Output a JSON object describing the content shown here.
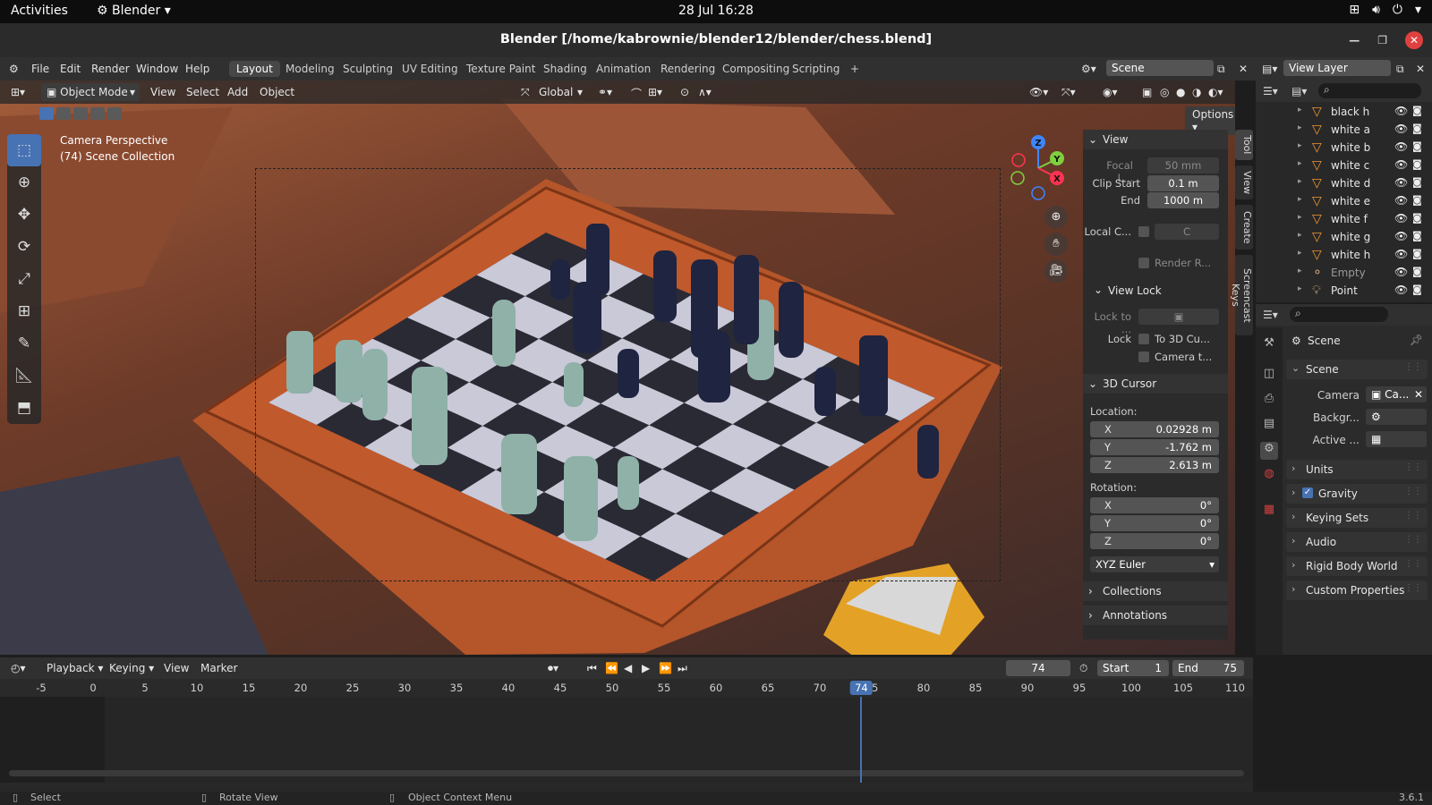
{
  "gnome": {
    "activities": "Activities",
    "app_name": "Blender",
    "clock": "28 Jul  16:28",
    "tray_icons": [
      "network-icon",
      "volume-icon",
      "power-icon"
    ]
  },
  "window": {
    "title": "Blender [/home/kabrownie/blender12/blender/chess.blend]"
  },
  "menu": {
    "items": [
      "File",
      "Edit",
      "Render",
      "Window",
      "Help"
    ],
    "workspaces": [
      "Layout",
      "Modeling",
      "Sculpting",
      "UV Editing",
      "Texture Paint",
      "Shading",
      "Animation",
      "Rendering",
      "Compositing",
      "Scripting"
    ],
    "active_workspace": "Layout",
    "add_tab": "+",
    "scene_name": "Scene",
    "view_layer": "View Layer"
  },
  "viewport": {
    "mode": "Object Mode",
    "menus": [
      "View",
      "Select",
      "Add",
      "Object"
    ],
    "transform_orientation": "Global",
    "options_label": "Options",
    "info_line1": "Camera Perspective",
    "info_line2": "(74) Scene Collection",
    "gizmo_axes": [
      "Z",
      "Y",
      "X"
    ]
  },
  "npanel": {
    "tabs": [
      "Tool",
      "View",
      "Create",
      "Screencast Keys"
    ],
    "view_header": "View",
    "focal_label": "Focal L...",
    "focal_value": "50 mm",
    "clip_start_label": "Clip Start",
    "clip_start_value": "0.1 m",
    "end_label": "End",
    "end_value": "1000 m",
    "local_camera_label": "Local C...",
    "local_camera_value": "C",
    "render_region": "Render R...",
    "view_lock_header": "View Lock",
    "lock_to_label": "Lock to ...",
    "lock_label": "Lock",
    "lock_3d_cursor": "To 3D Cu...",
    "lock_camera": "Camera t...",
    "cursor_header": "3D Cursor",
    "location_label": "Location:",
    "loc_x": "0.02928 m",
    "loc_y": "-1.762 m",
    "loc_z": "2.613 m",
    "rotation_label": "Rotation:",
    "rot_x": "0°",
    "rot_y": "0°",
    "rot_z": "0°",
    "rotation_mode": "XYZ Euler",
    "collections": "Collections",
    "annotations": "Annotations",
    "axis_x": "X",
    "axis_y": "Y",
    "axis_z": "Z"
  },
  "outliner": {
    "rows": [
      {
        "name": "black h",
        "type": "mesh"
      },
      {
        "name": "white a",
        "type": "mesh"
      },
      {
        "name": "white b",
        "type": "mesh"
      },
      {
        "name": "white c",
        "type": "mesh"
      },
      {
        "name": "white d",
        "type": "mesh"
      },
      {
        "name": "white e",
        "type": "mesh"
      },
      {
        "name": "white f",
        "type": "mesh"
      },
      {
        "name": "white g",
        "type": "mesh"
      },
      {
        "name": "white h",
        "type": "mesh"
      },
      {
        "name": "Empty",
        "type": "empty"
      },
      {
        "name": "Point",
        "type": "light"
      }
    ]
  },
  "properties": {
    "title": "Scene",
    "section": "Scene",
    "camera_label": "Camera",
    "camera_value": "Ca...",
    "background_label": "Backgr...",
    "active_label": "Active ...",
    "panels": [
      "Units",
      "Gravity",
      "Keying Sets",
      "Audio",
      "Rigid Body World",
      "Custom Properties"
    ],
    "gravity_checked": true
  },
  "timeline": {
    "menus": [
      "Playback",
      "Keying",
      "View",
      "Marker"
    ],
    "current_frame": "74",
    "start_label": "Start",
    "start_value": "1",
    "end_label": "End",
    "end_value": "75",
    "ticks": [
      "-5",
      "0",
      "5",
      "10",
      "15",
      "20",
      "25",
      "30",
      "35",
      "40",
      "45",
      "50",
      "55",
      "60",
      "65",
      "70",
      "75",
      "80",
      "85",
      "90",
      "95",
      "100",
      "105",
      "110"
    ]
  },
  "statusbar": {
    "select": "Select",
    "rotate": "Rotate View",
    "context": "Object Context Menu",
    "version": "3.6.1"
  },
  "colors": {
    "accent": "#4772b3",
    "board_wood": "#c0592c",
    "white_pieces": "#8fb1a8",
    "black_pieces": "#1f2440",
    "outliner_mesh": "#f09633"
  }
}
